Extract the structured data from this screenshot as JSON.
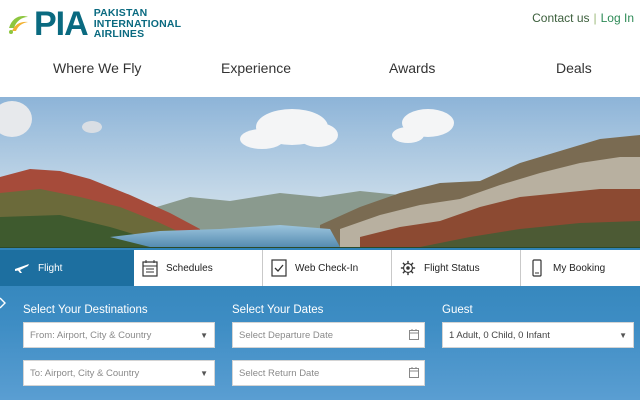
{
  "header": {
    "logo_main": "PIA",
    "logo_line1": "PAKISTAN",
    "logo_line2": "INTERNATIONAL",
    "logo_line3": "AIRLINES",
    "contact_label": "Contact us",
    "separator": "|",
    "login_label": "Log In"
  },
  "nav": {
    "items": [
      "Where We Fly",
      "Experience",
      "Awards",
      "Deals"
    ]
  },
  "tabs": [
    {
      "label": "Flight",
      "icon": "plane-icon",
      "active": true
    },
    {
      "label": "Schedules",
      "icon": "calendar-icon",
      "active": false
    },
    {
      "label": "Web Check-In",
      "icon": "web-checkin-icon",
      "active": false
    },
    {
      "label": "Flight Status",
      "icon": "gear-icon",
      "active": false
    },
    {
      "label": "My Booking",
      "icon": "mobile-icon",
      "active": false
    }
  ],
  "form": {
    "destinations_label": "Select Your Destinations",
    "dates_label": "Select Your Dates",
    "guest_label": "Guest",
    "from_placeholder": "From: Airport, City & Country",
    "to_placeholder": "To: Airport, City & Country",
    "departure_placeholder": "Select Departure Date",
    "return_placeholder": "Select Return Date",
    "guest_value": "1 Adult, 0 Child, 0 Infant"
  },
  "colors": {
    "brand_teal": "#0a6a80",
    "brand_green": "#8dc63f",
    "panel_blue": "#3e8dc4",
    "active_tab": "#1d6fa0"
  }
}
